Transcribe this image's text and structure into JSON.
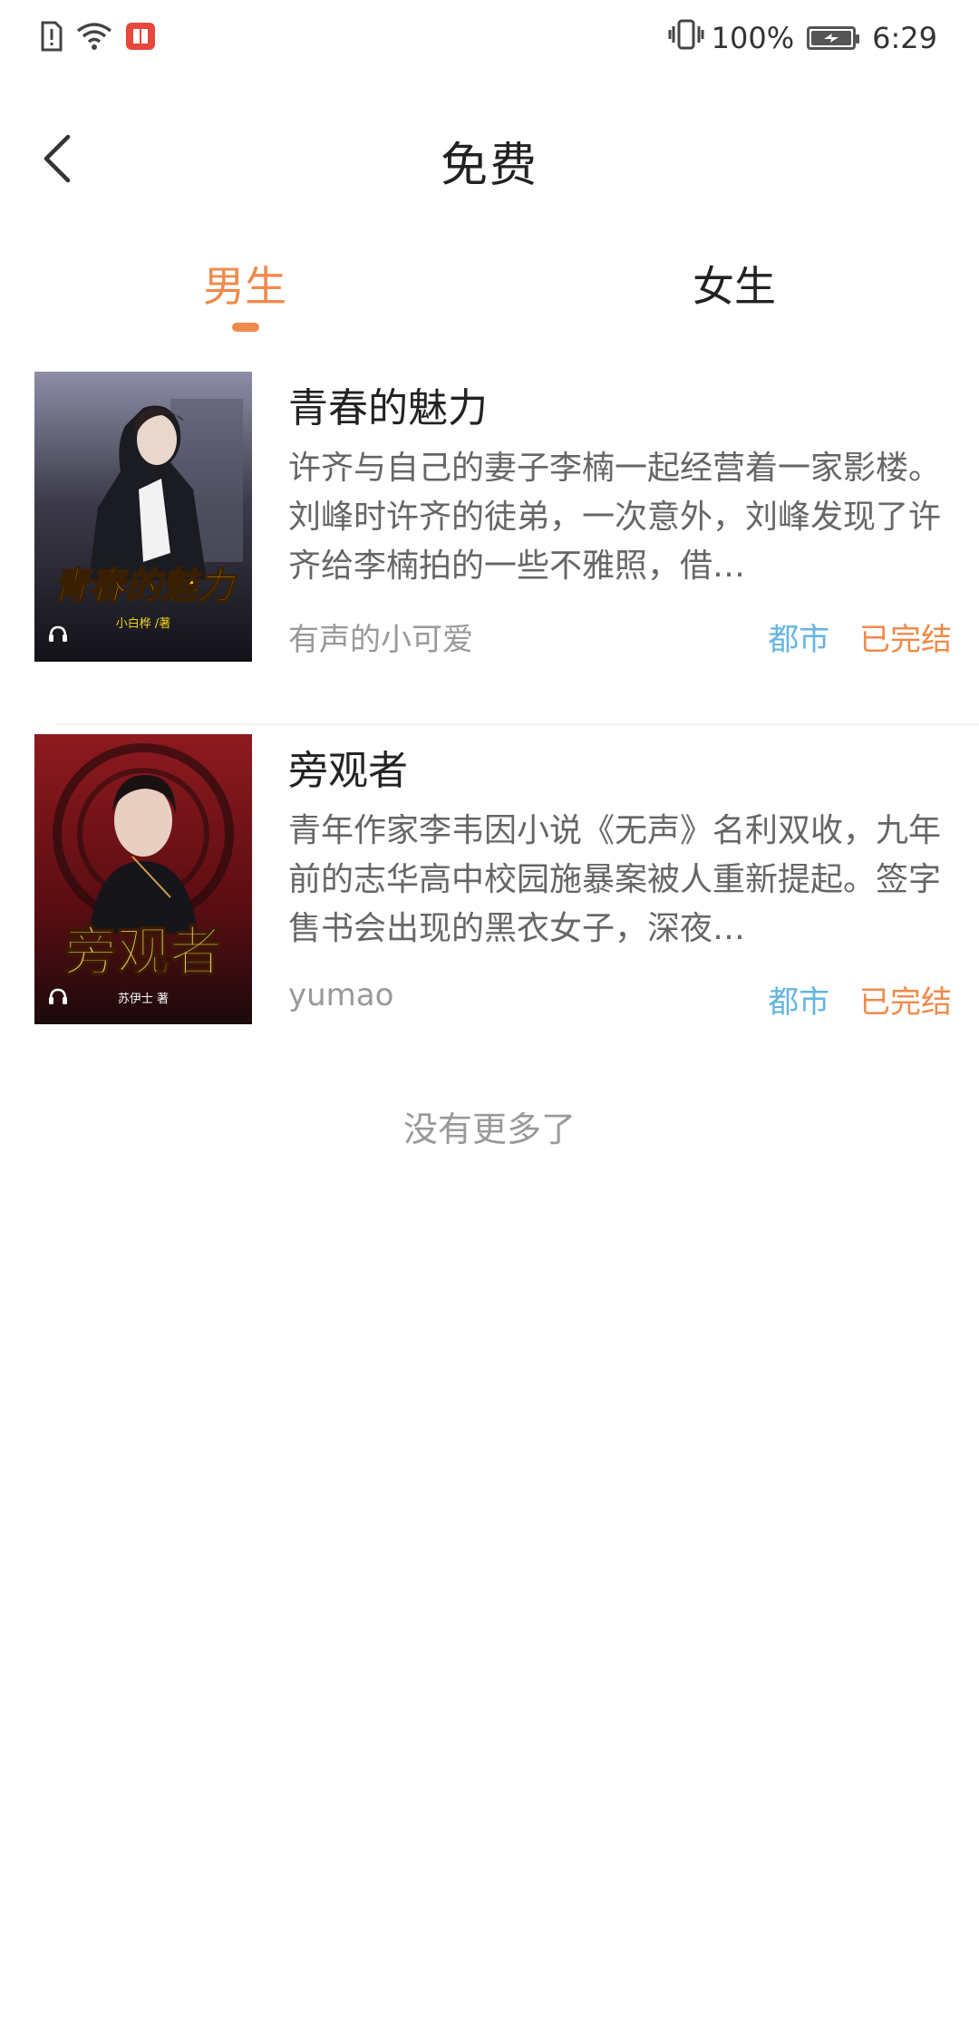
{
  "status_bar": {
    "battery_percent": "100%",
    "time": "6:29",
    "icons": [
      "sim-alert-icon",
      "wifi-icon",
      "app-notification-icon",
      "vibrate-icon",
      "battery-charging-icon"
    ]
  },
  "header": {
    "title": "免费",
    "back_icon": "chevron-left-icon"
  },
  "tabs": {
    "items": [
      {
        "label": "男生",
        "active": true
      },
      {
        "label": "女生",
        "active": false
      }
    ],
    "active_color": "#f08a4b"
  },
  "books": [
    {
      "title": "青春的魅力",
      "description": "许齐与自己的妻子李楠一起经营着一家影楼。刘峰时许齐的徒弟，一次意外，刘峰发现了许齐给李楠拍的一些不雅照，借…",
      "author": "有声的小可爱",
      "genre": "都市",
      "status": "已完结",
      "cover": {
        "title_text": "青春的魅力",
        "author_text": "小白桦 /著",
        "icon": "headphones-icon"
      }
    },
    {
      "title": "旁观者",
      "description": "青年作家李韦因小说《无声》名利双收，九年前的志华高中校园施暴案被人重新提起。签字售书会出现的黑衣女子，深夜…",
      "author": "yumao",
      "genre": "都市",
      "status": "已完结",
      "cover": {
        "title_text": "旁观者",
        "author_text": "苏伊士 著",
        "icon": "headphones-icon"
      }
    }
  ],
  "footer": {
    "no_more_text": "没有更多了"
  },
  "colors": {
    "accent": "#f08a4b",
    "genre_tag": "#64b5e0",
    "secondary_text": "#999999"
  }
}
